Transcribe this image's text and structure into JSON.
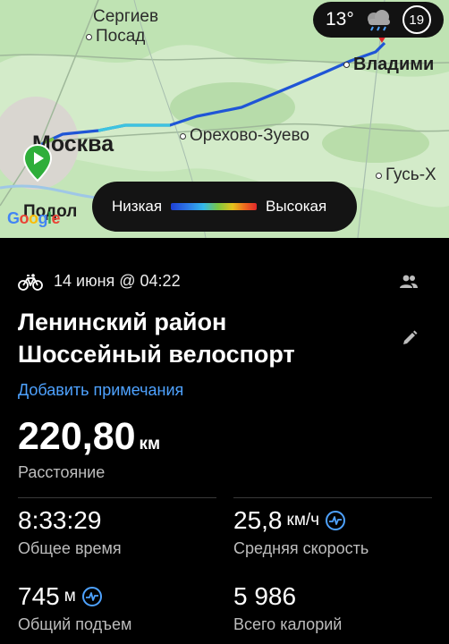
{
  "map": {
    "cities": {
      "sergiev_line1": "Сергиев",
      "sergiev_line2": "Посад",
      "vladimir": "Владими",
      "moscow": "Москва",
      "orekhovo": "Орехово-Зуево",
      "gus": "Гусь-Х",
      "podolsk": "Подол"
    },
    "google_letters": [
      "G",
      "o",
      "o",
      "g",
      "l",
      "e"
    ],
    "weather": {
      "temperature": "13°",
      "icon": "cloud-rain-icon",
      "aqi": "19"
    },
    "legend": {
      "low": "Низкая",
      "high": "Высокая"
    }
  },
  "activity": {
    "icon": "bicycle-icon",
    "datetime": "14 июня @ 04:22",
    "title_line1": "Ленинский район",
    "title_line2": "Шоссейный велоспорт",
    "add_note": "Добавить примечания",
    "distance": {
      "value": "220,80",
      "unit": "км",
      "label": "Расстояние"
    },
    "stats": {
      "total_time": {
        "value": "8:33:29",
        "unit": "",
        "label": "Общее время"
      },
      "avg_speed": {
        "value": "25,8",
        "unit": "км/ч",
        "label": "Средняя скорость"
      },
      "elevation": {
        "value": "745",
        "unit": "м",
        "label": "Общий подъем"
      },
      "calories": {
        "value": "5 986",
        "unit": "",
        "label": "Всего калорий"
      }
    }
  },
  "colors": {
    "accent": "#4ea2ff",
    "start_marker": "#2fae3a",
    "end_marker": "#e0272b"
  }
}
